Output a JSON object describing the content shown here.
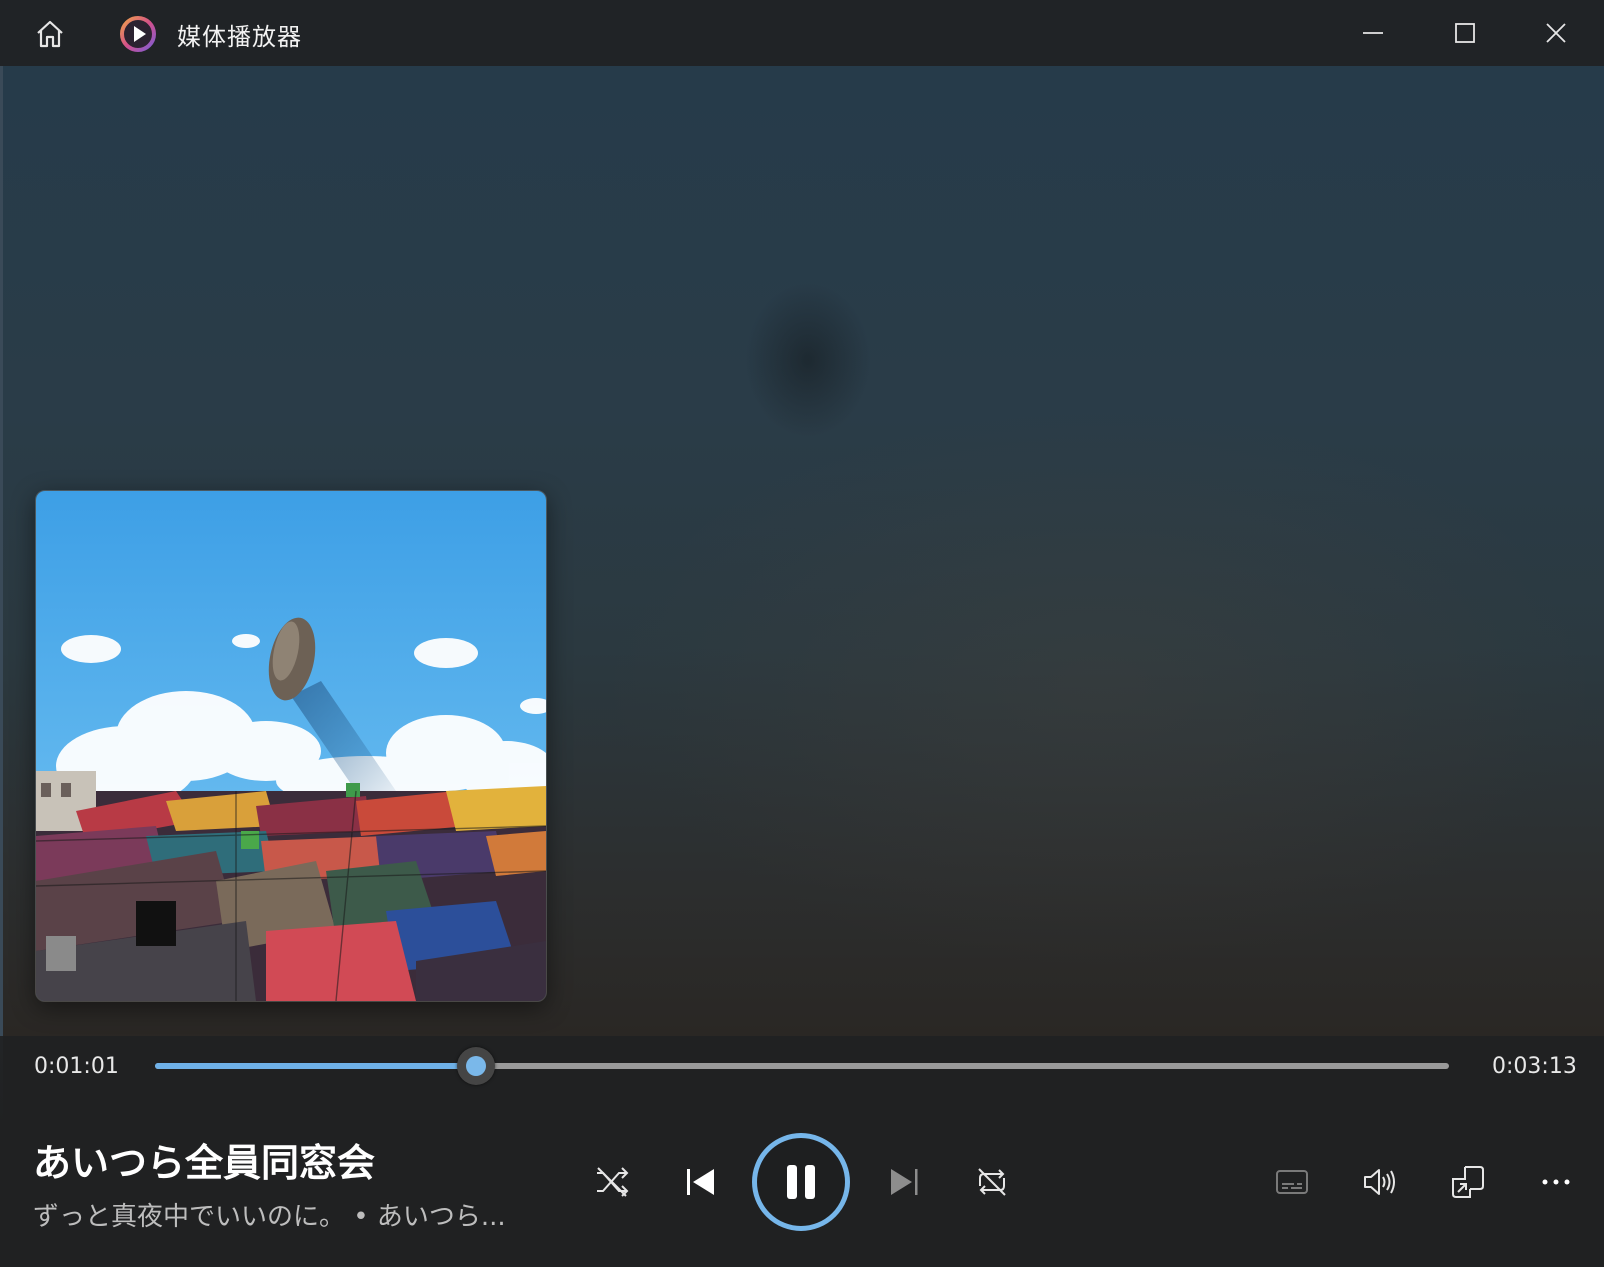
{
  "app": {
    "title": "媒体播放器"
  },
  "player": {
    "current_time": "0:01:01",
    "total_time": "0:03:13",
    "progress_fraction": 0.2477,
    "song_title": "あいつら全員同窓会",
    "artist_album": "ずっと真夜中でいいのに。 • あいつら..."
  },
  "icons": {
    "home": "home-icon",
    "app": "media-player-icon",
    "minimize": "minimize-icon",
    "maximize": "maximize-icon",
    "close": "close-icon",
    "shuffle": "shuffle-icon",
    "previous": "previous-track-icon",
    "pause": "pause-icon",
    "next": "next-track-icon",
    "repeat": "repeat-icon",
    "subtitles": "subtitles-icon",
    "volume": "volume-icon",
    "mini_player": "mini-player-icon",
    "more": "more-icon"
  },
  "colors": {
    "accent": "#76b6ea",
    "titlebar": "#202326",
    "bottombar": "#202122"
  }
}
